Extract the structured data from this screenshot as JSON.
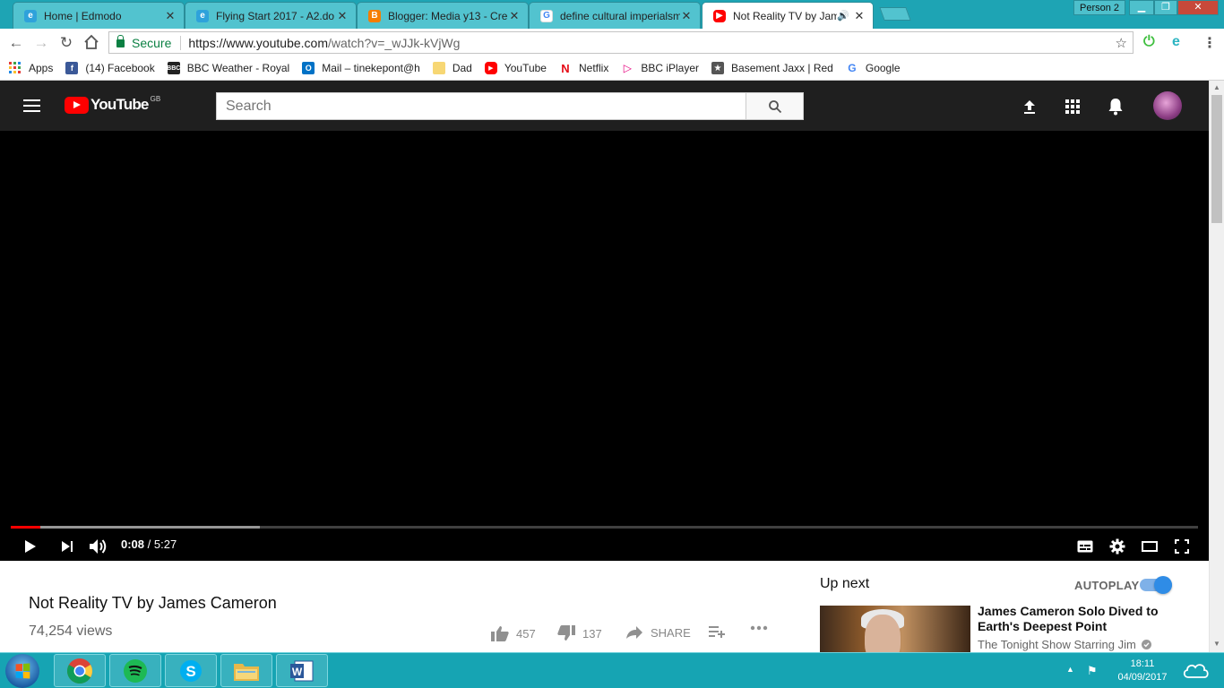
{
  "browser": {
    "tabs": [
      {
        "title": "Home | Edmodo",
        "favicon": "edmodo-icon",
        "active": false
      },
      {
        "title": "Flying Start 2017 - A2.do",
        "favicon": "edmodo-icon",
        "active": false
      },
      {
        "title": "Blogger: Media y13 - Cre",
        "favicon": "blogger-icon",
        "active": false
      },
      {
        "title": "define cultural imperialsm",
        "favicon": "google-icon",
        "active": false
      },
      {
        "title": "Not Reality TV by Jam",
        "favicon": "youtube-icon",
        "active": true,
        "audio": true
      }
    ],
    "person_label": "Person 2",
    "omnibox": {
      "secure_label": "Secure",
      "url_host": "https://www.youtube.com",
      "url_path": "/watch?v=_wJJk-kVjWg"
    },
    "bookmarks": [
      {
        "label": "Apps",
        "icon": "apps-grid-icon"
      },
      {
        "label": "(14) Facebook",
        "icon": "facebook-icon"
      },
      {
        "label": "BBC Weather - Royal",
        "icon": "bbc-icon"
      },
      {
        "label": "Mail – tinekepont@h",
        "icon": "outlook-icon"
      },
      {
        "label": "Dad",
        "icon": "folder-icon"
      },
      {
        "label": "YouTube",
        "icon": "youtube-icon"
      },
      {
        "label": "Netflix",
        "icon": "netflix-icon"
      },
      {
        "label": "BBC iPlayer",
        "icon": "iplayer-icon"
      },
      {
        "label": "Basement Jaxx | Red",
        "icon": "star-icon"
      },
      {
        "label": "Google",
        "icon": "google-icon"
      }
    ]
  },
  "youtube": {
    "logo_text": "YouTube",
    "logo_region": "GB",
    "search_placeholder": "Search",
    "player": {
      "current_time": "0:08",
      "duration": "5:27",
      "played_fraction": 0.025,
      "buffered_fraction": 0.21
    },
    "video": {
      "title": "Not Reality TV by James Cameron",
      "views": "74,254 views",
      "likes": "457",
      "dislikes": "137",
      "share_label": "SHARE"
    },
    "sidebar": {
      "up_next_label": "Up next",
      "autoplay_label": "AUTOPLAY",
      "autoplay_on": true,
      "next_video": {
        "title": "James Cameron Solo Dived to Earth's Deepest Point",
        "channel": "The Tonight Show Starring Jim"
      }
    },
    "colors": {
      "brand_red": "#ff0000",
      "masthead": "#1f1f1f",
      "toggle_blue": "#2f8ce6"
    }
  },
  "taskbar": {
    "apps": [
      "chrome-icon",
      "spotify-icon",
      "skype-icon",
      "file-explorer-icon",
      "word-icon"
    ],
    "clock_time": "18:11",
    "clock_date": "04/09/2017"
  }
}
